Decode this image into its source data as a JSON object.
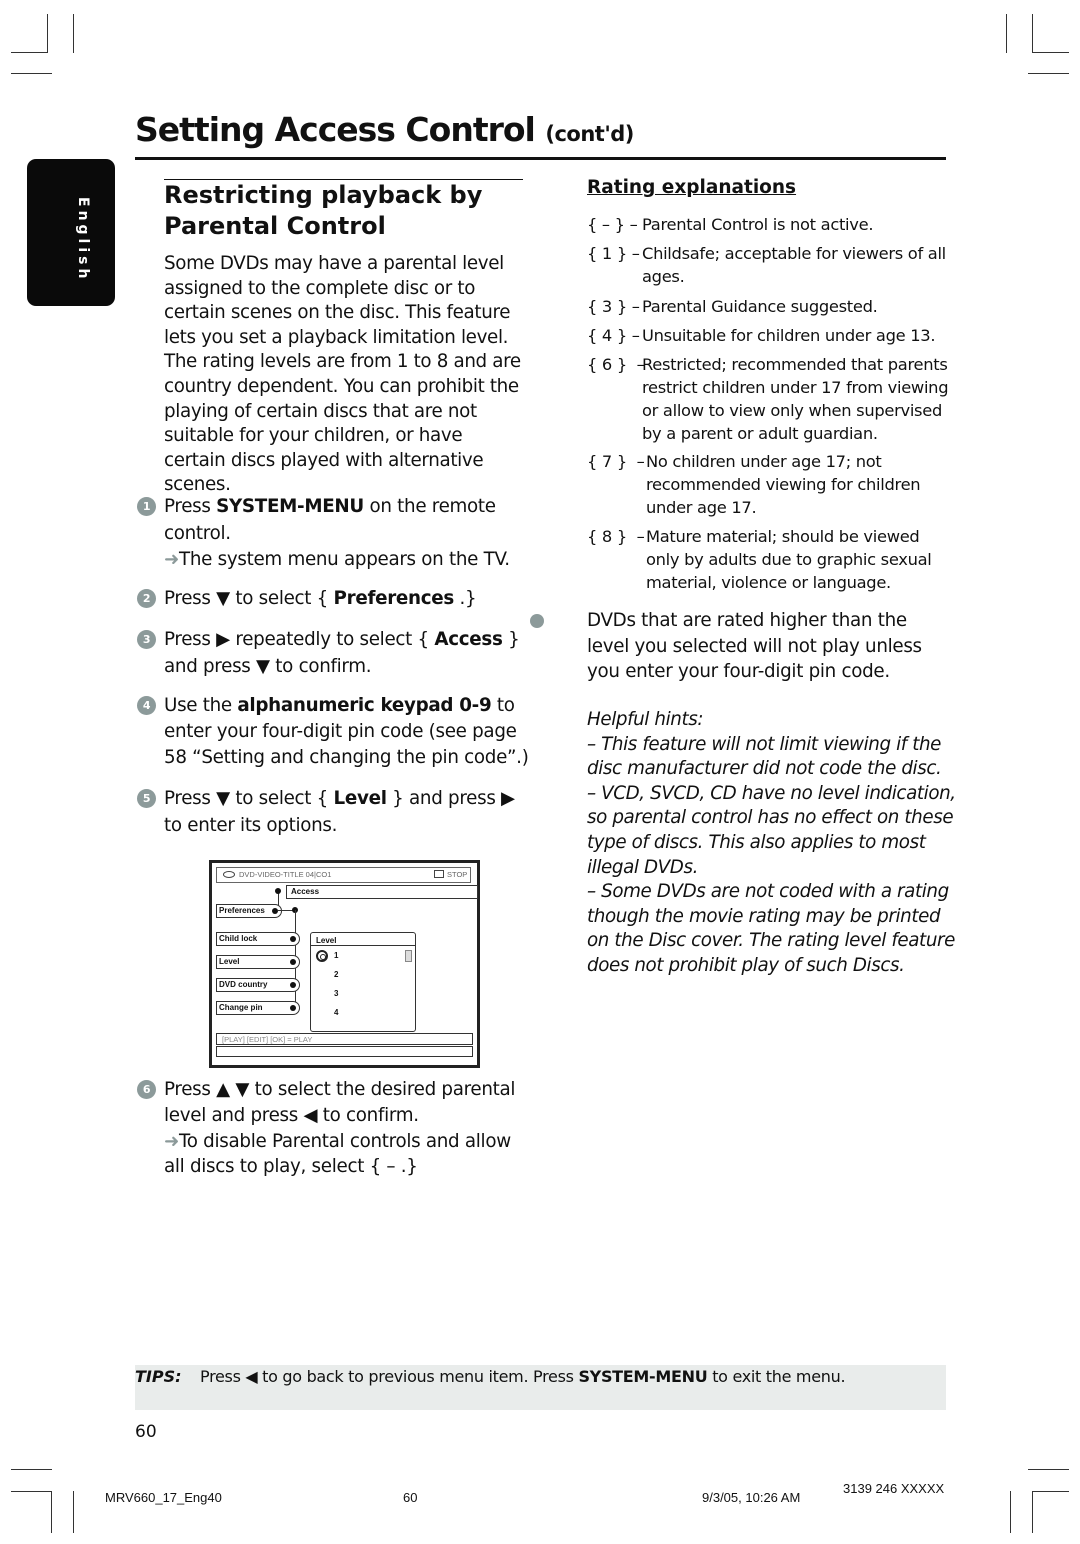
{
  "header": {
    "title": "Setting Access Control",
    "title_suffix": "(cont'd)",
    "language_tab": "English"
  },
  "section": {
    "title_line1": "Restricting playback by",
    "title_line2": "Parental Control",
    "intro": "Some DVDs may have a parental level assigned to the complete disc or to certain scenes on the disc. This feature lets you set a playback limitation level. The rating levels are from 1 to 8 and are country dependent. You can prohibit the playing of certain discs that are not suitable for your children, or have certain discs played with alternative scenes."
  },
  "steps": [
    {
      "num": "1",
      "pre": "Press ",
      "bold": "SYSTEM-MENU",
      "post": " on the remote control.",
      "result": "The system menu appears on the TV."
    },
    {
      "num": "2",
      "pre": "Press ▼ to select { ",
      "bold": "Preferences",
      "post": " .}"
    },
    {
      "num": "3",
      "pre": "Press ▶ repeatedly to select { ",
      "bold": "Access",
      "post": " } and press ▼  to confirm."
    },
    {
      "num": "4",
      "pre": "Use the ",
      "bold": "alphanumeric keypad 0-9",
      "post": " to enter your four-digit pin code (see page 58 “Setting and changing the pin code”.)"
    },
    {
      "num": "5",
      "pre": "Press ▼ to select { ",
      "bold": "Level",
      "post": " } and press ▶ to enter its options."
    },
    {
      "num": "6",
      "pre": "Press ▲ ▼ to select the desired parental level and press ◀  to confirm.",
      "result": "To disable Parental controls and allow all discs to play, select { – .}"
    }
  ],
  "osd": {
    "status_title": "DVD-VIDEO-TITLE 04|CO1",
    "status_state": "STOP",
    "breadcrumb": "Access",
    "parent_item": "Preferences",
    "menu_items": [
      "Child lock",
      "Level",
      "DVD country",
      "Change pin"
    ],
    "submenu_title": "Level",
    "submenu_options": [
      "1",
      "2",
      "3",
      "4"
    ],
    "help_text": "[PLAY] [EDIT] [OK] = PLAY"
  },
  "ratings": {
    "title": "Rating explanations",
    "items": [
      {
        "code": "{ – } –",
        "desc": "Parental Control is not active."
      },
      {
        "code": "{ 1 } –",
        "desc": "Childsafe; acceptable for viewers of all ages."
      },
      {
        "code": "{ 3 } –",
        "desc": "Parental Guidance suggested."
      },
      {
        "code": "{ 4 } –",
        "desc": "Unsuitable for children under age 13."
      },
      {
        "code": "{ 6 }  –",
        "desc": "Restricted; recommended that parents restrict children under 17 from viewing or allow to view only when supervised by a parent or adult guardian."
      },
      {
        "code": "{ 7 }  –",
        "desc": "No children under age 17; not recommended viewing for children under age 17."
      },
      {
        "code": "{ 8 }  –",
        "desc": "Mature material; should be viewed only by adults due to graphic sexual material, violence or language."
      }
    ],
    "note": "DVDs that are rated higher than the level you selected will not play unless you enter your four-digit pin code."
  },
  "hints": {
    "title": "Helpful hints:",
    "items": [
      "–  This feature will not limit viewing if the disc manufacturer did not code the disc.",
      "–  VCD, SVCD, CD have no level indication, so parental control has no effect on these type of discs. This also applies to most illegal DVDs.",
      "–  Some DVDs are not coded with a rating though the movie rating may be printed on the Disc cover. The rating level feature does not prohibit play of such Discs."
    ]
  },
  "tips": {
    "label": "TIPS:",
    "pre": "Press ◀ to go back to previous menu item.  Press ",
    "bold": "SYSTEM-MENU",
    "post": " to exit the menu."
  },
  "page_number": "60",
  "footer": {
    "file": "MRV660_17_Eng40",
    "page": "60",
    "datetime": "9/3/05, 10:26 AM",
    "code": "3139 246 XXXXX"
  }
}
